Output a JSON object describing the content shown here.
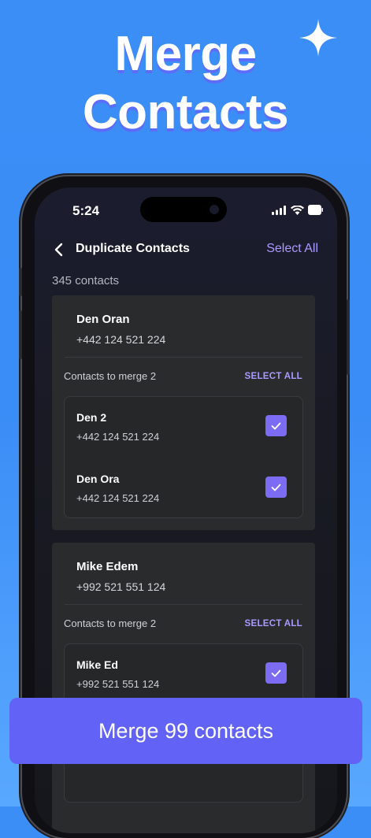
{
  "promo": {
    "headline_line1": "Merge",
    "headline_line2": "Contacts"
  },
  "status_bar": {
    "time": "5:24"
  },
  "nav": {
    "title": "Duplicate Contacts",
    "select_all": "Select All"
  },
  "contacts_count": "345 contacts",
  "groups": [
    {
      "name": "Den Oran",
      "phone": "+442 124 521 224",
      "merge_label": "Contacts to merge 2",
      "select_all": "SELECT ALL",
      "duplicates": [
        {
          "name": "Den 2",
          "phone": "+442 124 521 224",
          "checked": true
        },
        {
          "name": "Den Ora",
          "phone": "+442 124 521 224",
          "checked": true
        }
      ]
    },
    {
      "name": "Mike Edem",
      "phone": "+992 521 551 124",
      "merge_label": "Contacts to merge 2",
      "select_all": "SELECT ALL",
      "duplicates": [
        {
          "name": "Mike Ed",
          "phone": "+992 521 551 124",
          "checked": true
        }
      ]
    }
  ],
  "merge_button": "Merge 99 contacts",
  "colors": {
    "accent": "#7c6cf3",
    "button": "#6362f6",
    "link": "#a99bff",
    "background": "#3c8ef7"
  }
}
